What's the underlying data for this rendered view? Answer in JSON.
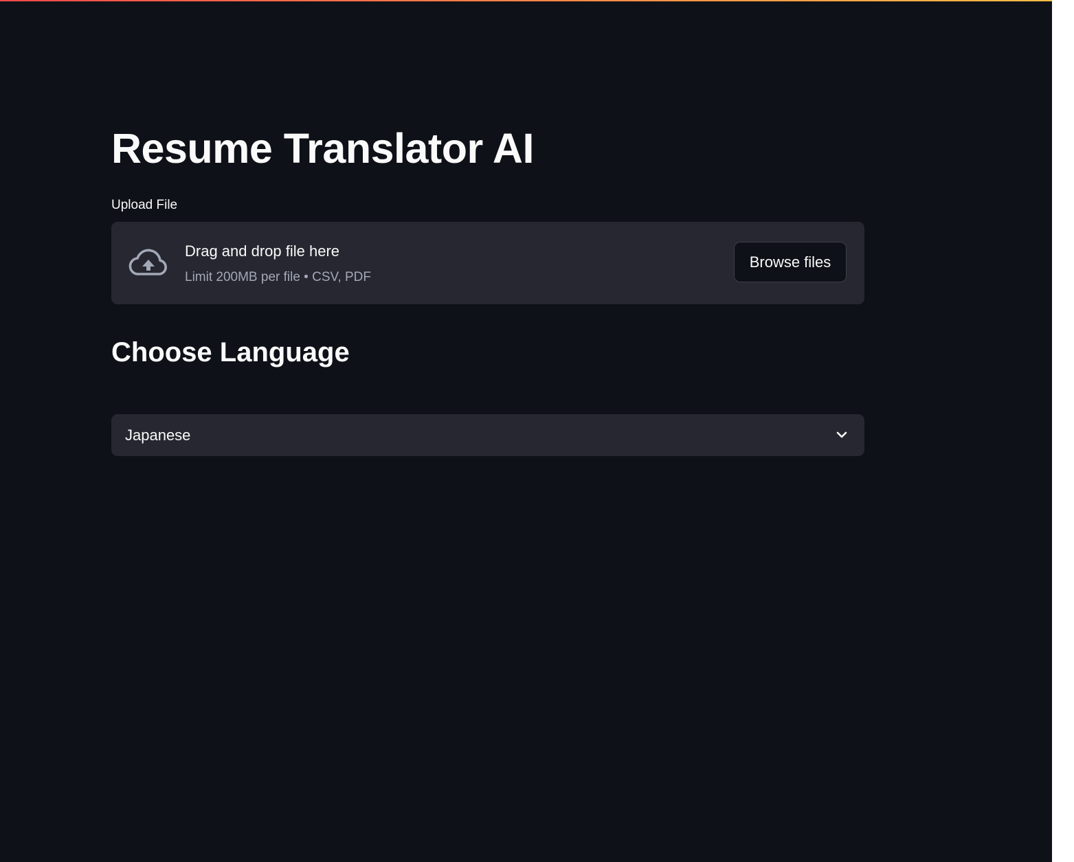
{
  "app": {
    "title": "Resume Translator AI"
  },
  "upload": {
    "label": "Upload File",
    "dropzone_text": "Drag and drop file here",
    "limit_text": "Limit 200MB per file • CSV, PDF",
    "browse_label": "Browse files",
    "icon": "cloud-upload-icon"
  },
  "language": {
    "heading": "Choose Language",
    "selected": "Japanese",
    "icon": "chevron-down-icon"
  },
  "colors": {
    "background": "#0e1117",
    "panel": "#262730",
    "text": "#fafafa",
    "muted_text": "#a3a8b8",
    "accent_gradient_start": "#ff4b4b",
    "accent_gradient_end": "#ffbd45"
  }
}
